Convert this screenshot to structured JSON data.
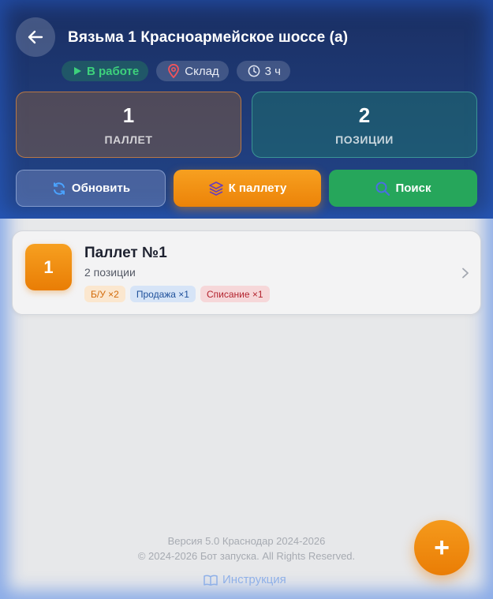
{
  "header": {
    "title": "Вязьма 1 Красноармейское шоссе (а)",
    "status_label": "В работе",
    "location_label": "Склад",
    "time_label": "3 ч"
  },
  "stats": {
    "pallets": {
      "value": "1",
      "label": "ПАЛЛЕТ"
    },
    "positions": {
      "value": "2",
      "label": "ПОЗИЦИИ"
    }
  },
  "actions": {
    "refresh_label": "Обновить",
    "to_pallet_label": "К паллету",
    "search_label": "Поиск"
  },
  "pallets": [
    {
      "number": "1",
      "title": "Паллет №1",
      "subtitle": "2 позиции",
      "tags": [
        "Б/У ×2",
        "Продажа ×1",
        "Списание ×1"
      ]
    }
  ],
  "footer": {
    "version": "Версия 5.0 Краснодар 2024-2026",
    "copyright": "© 2024-2026 Бот запуска. All Rights Reserved.",
    "help_link": "Инструкция"
  },
  "fab_label": "+",
  "colors": {
    "accent_orange": "#f08a0f",
    "success_green": "#26a65b",
    "header_navy": "#1f3b78"
  },
  "icons": [
    "back-arrow-icon",
    "play-icon",
    "location-pin-icon",
    "clock-icon",
    "refresh-icon",
    "layers-icon",
    "search-icon",
    "chevron-right-icon",
    "book-icon",
    "plus-icon"
  ]
}
